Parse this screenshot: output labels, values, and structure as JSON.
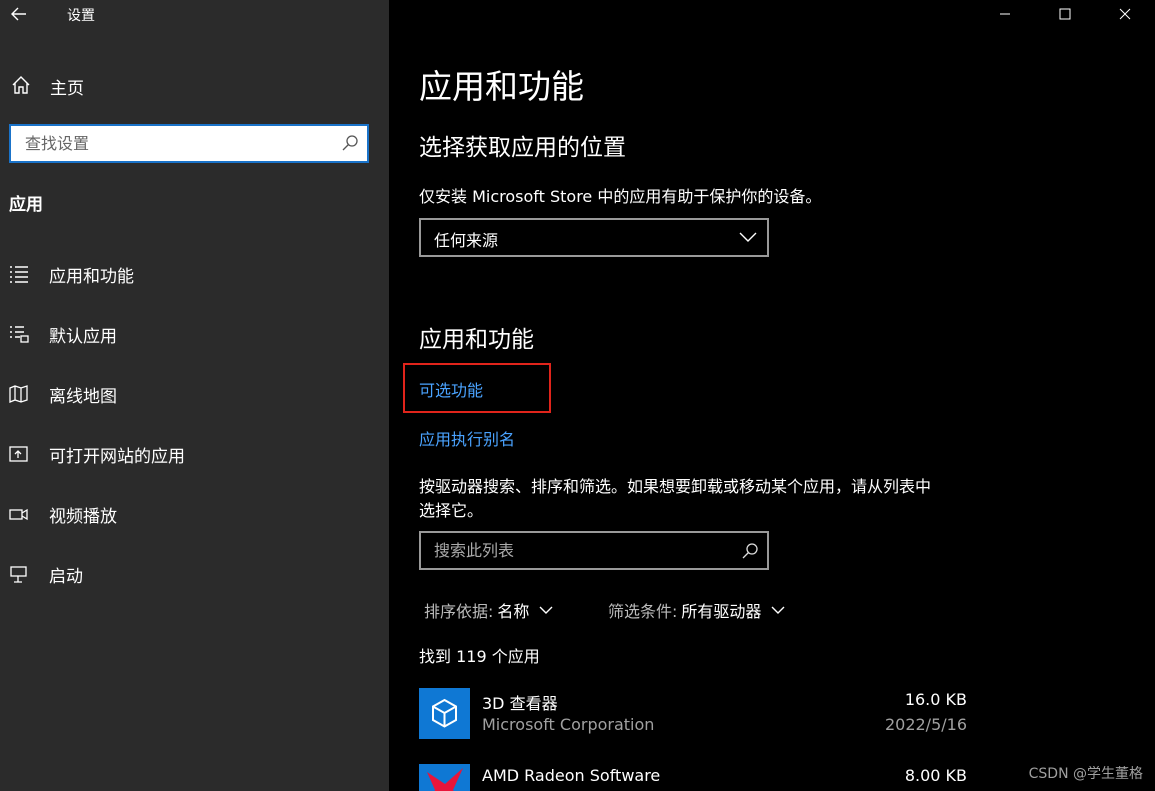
{
  "window": {
    "title": "设置"
  },
  "sidebar": {
    "home_label": "主页",
    "search_placeholder": "查找设置",
    "section_heading": "应用",
    "items": [
      {
        "label": "应用和功能",
        "icon": "list-icon"
      },
      {
        "label": "默认应用",
        "icon": "default-apps-icon"
      },
      {
        "label": "离线地图",
        "icon": "map-icon"
      },
      {
        "label": "可打开网站的应用",
        "icon": "open-website-icon"
      },
      {
        "label": "视频播放",
        "icon": "video-icon"
      },
      {
        "label": "启动",
        "icon": "startup-icon"
      }
    ]
  },
  "main": {
    "page_title": "应用和功能",
    "install_heading": "选择获取应用的位置",
    "install_desc": "仅安装 Microsoft Store 中的应用有助于保护你的设备。",
    "install_source_value": "任何来源",
    "apps_heading": "应用和功能",
    "optional_features_link": "可选功能",
    "app_alias_link": "应用执行别名",
    "search_desc_line1": "按驱动器搜索、排序和筛选。如果想要卸载或移动某个应用，请从列表中",
    "search_desc_line2": "选择它。",
    "list_search_placeholder": "搜索此列表",
    "sort_key": "排序依据:",
    "sort_value": "名称",
    "filter_key": "筛选条件:",
    "filter_value": "所有驱动器",
    "count_text": "找到 119 个应用",
    "apps": [
      {
        "name": "3D 查看器",
        "publisher": "Microsoft Corporation",
        "size": "16.0 KB",
        "date": "2022/5/16"
      },
      {
        "name": "AMD Radeon Software",
        "publisher": "",
        "size": "8.00 KB",
        "date": ""
      }
    ]
  },
  "watermark": "CSDN @学生董格",
  "colors": {
    "accent": "#1a73c9",
    "link": "#4aa3ff",
    "highlight": "#e0241b",
    "sidebar_bg": "#2b2b2b"
  }
}
